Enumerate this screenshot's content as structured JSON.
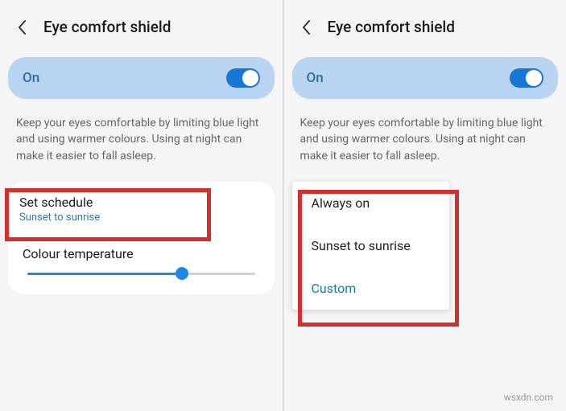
{
  "left": {
    "header_title": "Eye comfort shield",
    "toggle_label": "On",
    "description": "Keep your eyes comfortable by limiting blue light and using warmer colours. Using at night can make it easier to fall asleep.",
    "schedule_title": "Set schedule",
    "schedule_value": "Sunset to sunrise",
    "temp_title": "Colour temperature"
  },
  "right": {
    "header_title": "Eye comfort shield",
    "toggle_label": "On",
    "description": "Keep your eyes comfortable by limiting blue light and using warmer colours. Using at night can make it easier to fall asleep.",
    "menu": {
      "item1": "Always on",
      "item2": "Sunset to sunrise",
      "item3": "Custom"
    }
  },
  "watermark": "wsxdn.com"
}
